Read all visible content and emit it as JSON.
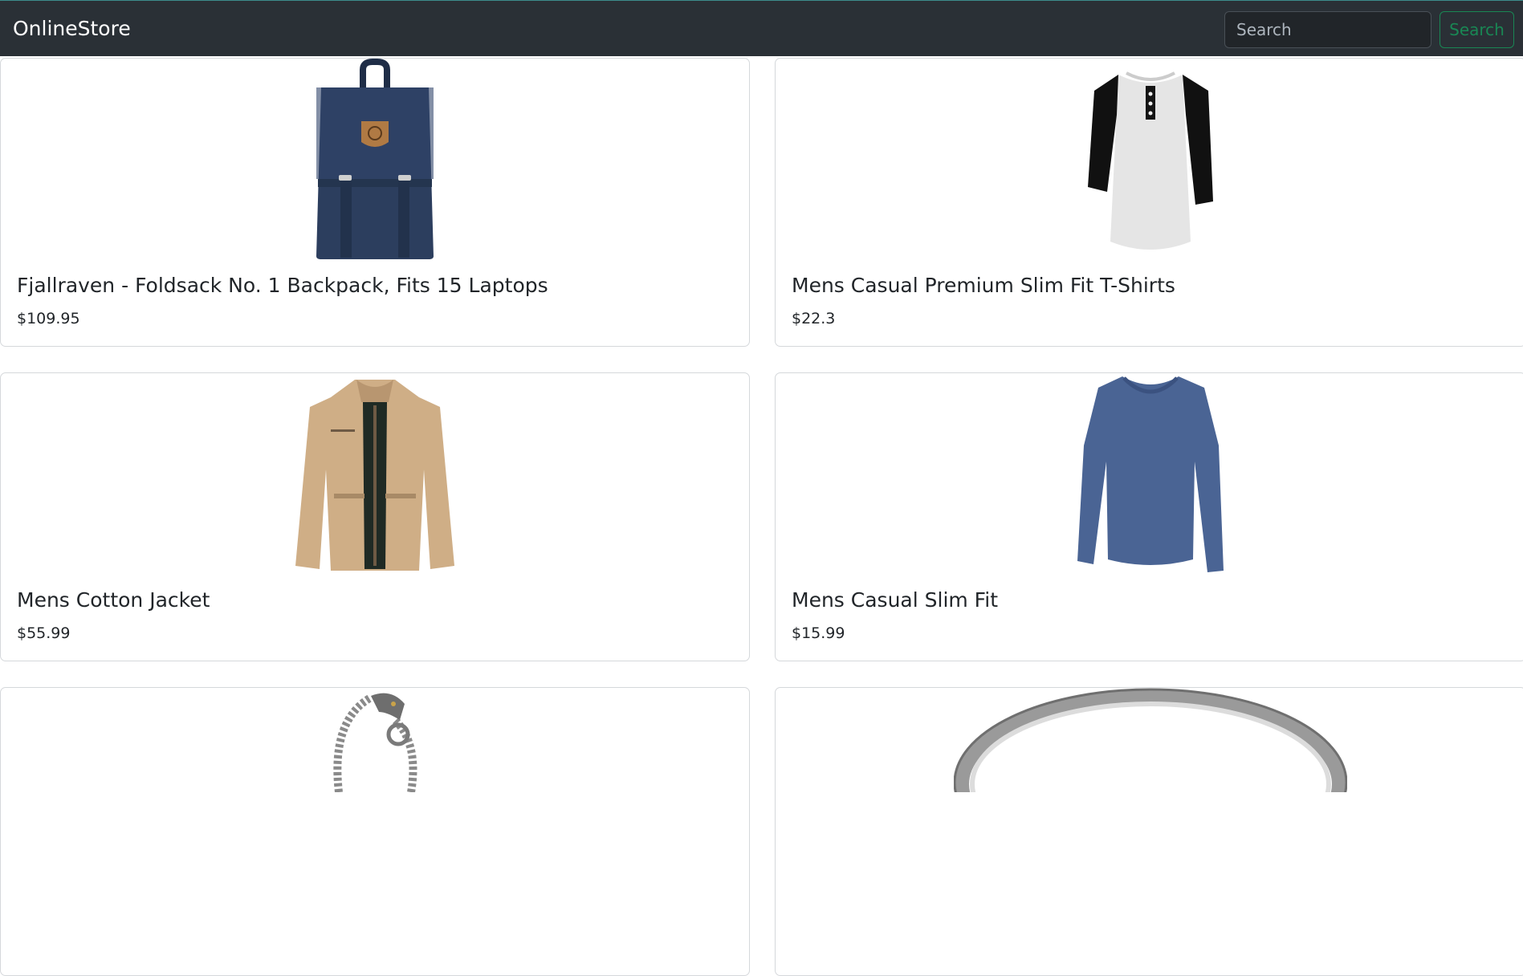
{
  "navbar": {
    "brand": "OnlineStore",
    "search_placeholder": "Search",
    "search_button": "Search"
  },
  "products": [
    {
      "title": "Fjallraven - Foldsack No. 1 Backpack, Fits 15 Laptops",
      "price": "$109.95",
      "image": "backpack"
    },
    {
      "title": "Mens Casual Premium Slim Fit T-Shirts",
      "price": "$22.3",
      "image": "raglan-tshirt"
    },
    {
      "title": "Mens Cotton Jacket",
      "price": "$55.99",
      "image": "jacket"
    },
    {
      "title": "Mens Casual Slim Fit",
      "price": "$15.99",
      "image": "longsleeve-shirt"
    },
    {
      "title": "",
      "price": "",
      "image": "chain-bracelet"
    },
    {
      "title": "",
      "price": "",
      "image": "silver-ring"
    }
  ]
}
